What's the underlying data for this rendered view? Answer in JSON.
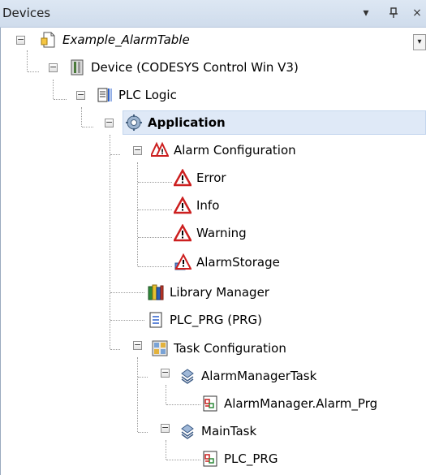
{
  "panel": {
    "title": "Devices",
    "menu_glyph": "▾",
    "pin_glyph": "ꟼ",
    "close_glyph": "×"
  },
  "tree": {
    "project": "Example_AlarmTable",
    "device": "Device (CODESYS Control Win V3)",
    "plc_logic": "PLC Logic",
    "application": "Application",
    "alarm_configuration": "Alarm Configuration",
    "alarm_error": "Error",
    "alarm_info": "Info",
    "alarm_warning": "Warning",
    "alarm_storage": "AlarmStorage",
    "library_manager": "Library Manager",
    "plc_prg": "PLC_PRG (PRG)",
    "task_configuration": "Task Configuration",
    "alarm_manager_task": "AlarmManagerTask",
    "alarm_manager_call": "AlarmManager.Alarm_Prg",
    "main_task": "MainTask",
    "main_task_call": "PLC_PRG"
  },
  "icons": {
    "project": "project-file-icon",
    "device": "device-icon",
    "plc_logic": "plc-logic-icon",
    "application": "application-gear-icon",
    "alarm_configuration": "alarm-configuration-icon",
    "alarm_class": "alarm-warning-triangle-icon",
    "alarm_storage": "alarm-storage-icon",
    "library_manager": "library-books-icon",
    "pou": "program-document-icon",
    "task_configuration": "task-configuration-icon",
    "task": "task-icon",
    "program_call": "program-call-icon"
  },
  "expander_collapse_glyph": "−",
  "colors": {
    "selection": "#dfe9f7",
    "title_bar": "#d6e2f0",
    "alarm_red": "#cc1f1f"
  }
}
